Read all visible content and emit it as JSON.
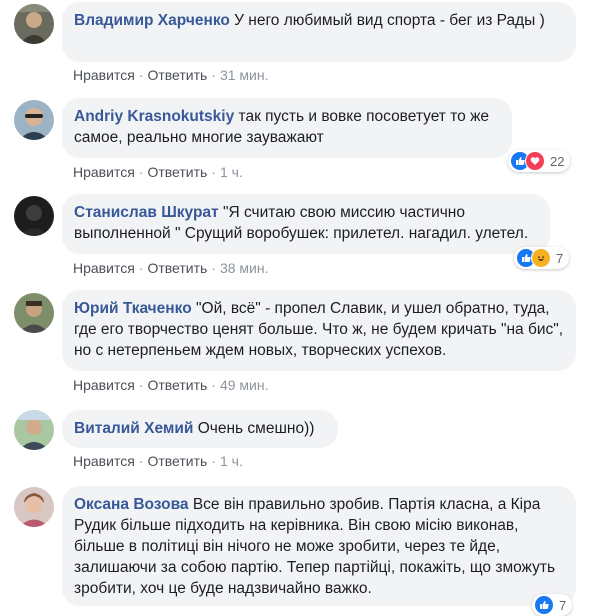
{
  "actions": {
    "like": "Нравится",
    "reply": "Ответить",
    "dot": "·"
  },
  "comments": [
    {
      "author": "Владимир Харченко",
      "text": "У него любимый вид спорта - бег из Рады )",
      "time": "31 мин."
    },
    {
      "author": "Andriy Krasnokutskiy",
      "text": "так пусть и вовке посоветует то же самое, реально многие зауважают",
      "time": "1 ч.",
      "reactions": {
        "count": "22",
        "icons": [
          "like-reaction-icon",
          "love-reaction-icon"
        ]
      }
    },
    {
      "author": "Станислав Шкурат",
      "text": "\"Я считаю свою миссию частично выполненной \" Срущий воробушек: прилетел. нагадил. улетел.",
      "time": "38 мин.",
      "reactions": {
        "count": "7",
        "icons": [
          "like-reaction-icon",
          "haha-reaction-icon"
        ]
      }
    },
    {
      "author": "Юрий Ткаченко",
      "text": "\"Ой, всё\" - пропел Славик, и ушел обратно, туда, где его творчество ценят больше. Что ж, не будем кричать \"на бис\", но с нетерпеньем ждем новых, творческих успехов.",
      "time": "49 мин."
    },
    {
      "author": "Виталий Хемий",
      "text": "Очень смешно))",
      "time": "1 ч."
    },
    {
      "author": "Оксана Возова",
      "text": "Все він правильно зробив. Партія класна, а Кіра Рудик більше підходить на керівника. Він свою місію виконав, більше в політиці він нічого не може зробити, через те йде, залишаючи за собою партію. Тепер партійці, покажіть, що зможуть зробити, хоч це буде надзвичайно важко.",
      "reactions": {
        "count": "7",
        "icons": [
          "like-reaction-icon"
        ]
      }
    }
  ],
  "colors": {
    "link": "#385898",
    "bubble": "#f2f3f5",
    "like": "#1877f2",
    "love": "#f33e58",
    "haha": "#f7b125"
  }
}
